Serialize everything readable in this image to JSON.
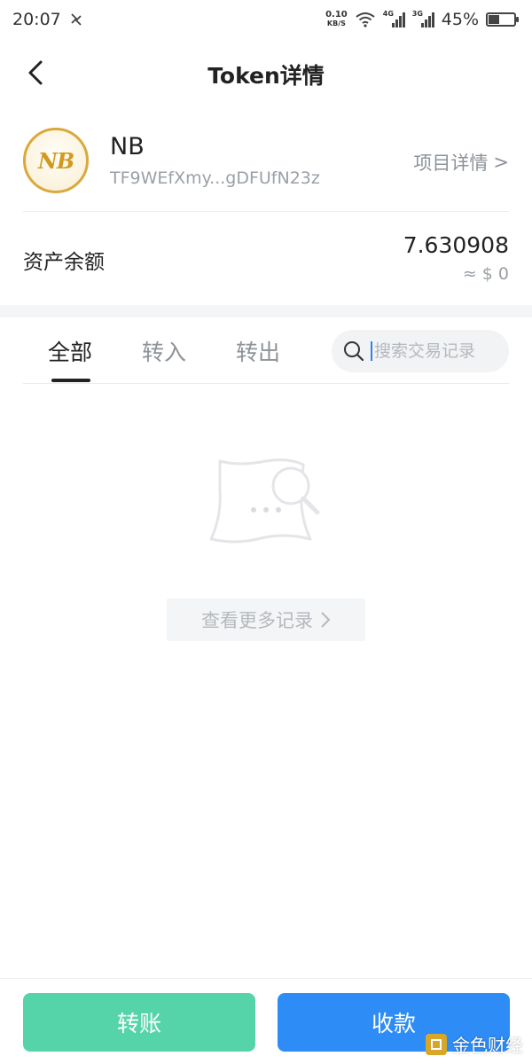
{
  "status_bar": {
    "time": "20:07",
    "net_speed_value": "0.10",
    "net_speed_unit": "KB/S",
    "signal1_label": "4G",
    "signal2_label": "3G",
    "battery": "45%"
  },
  "nav": {
    "title": "Token详情"
  },
  "token": {
    "name": "NB",
    "logo_text": "NB",
    "address": "TF9WEfXmy...gDFUfN23z",
    "project_link": "项目详情",
    "project_link_arrow": ">"
  },
  "balance": {
    "label": "资产余额",
    "value": "7.630908",
    "fiat": "≈ $  0"
  },
  "tabs": {
    "all": "全部",
    "in": "转入",
    "out": "转出"
  },
  "search": {
    "placeholder": "搜索交易记录",
    "value": ""
  },
  "more_records": "查看更多记录",
  "buttons": {
    "transfer": "转账",
    "receive": "收款"
  },
  "watermark": "金色财经",
  "colors": {
    "transfer_button": "#56d4a9",
    "receive_button": "#2d8cf5",
    "token_gold": "#d9a93d"
  }
}
